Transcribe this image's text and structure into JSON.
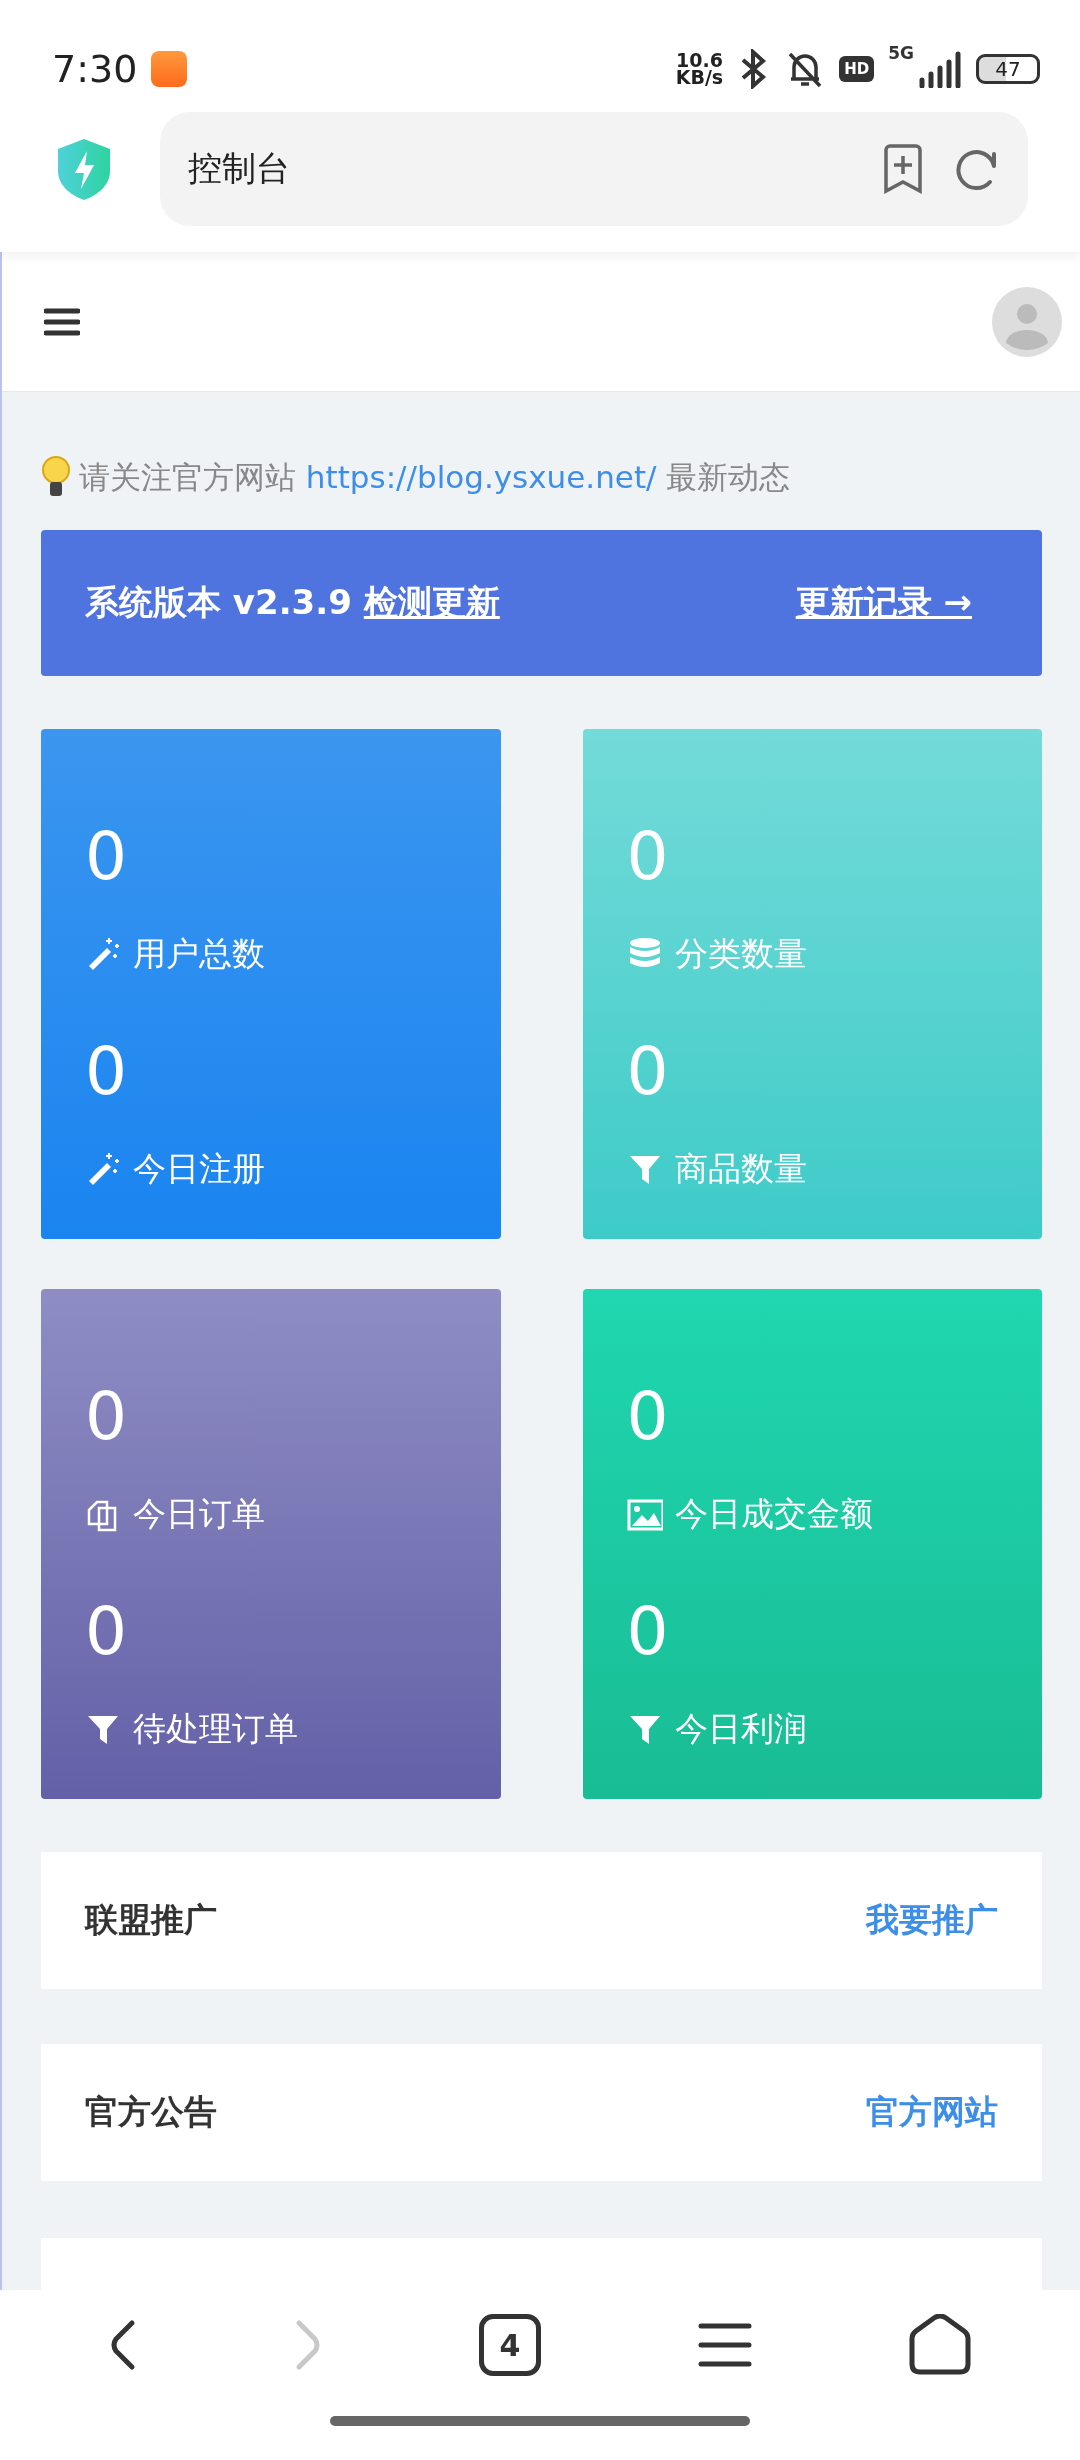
{
  "status_bar": {
    "time": "7:30",
    "speed_value": "10.6",
    "speed_unit": "KB/s",
    "hd": "HD",
    "network": "5G",
    "battery": "47"
  },
  "browser": {
    "address": "控制台",
    "tab_count": "4"
  },
  "notice": {
    "before": "请关注官方网站",
    "link": "https://blog.ysxue.net/",
    "after": "最新动态"
  },
  "version_banner": {
    "label": "系统版本 v2.3.9",
    "check_link": "检测更新",
    "changelog_link": "更新记录 →"
  },
  "cards": [
    {
      "kind": "blue",
      "stats": [
        {
          "value": "0",
          "label": "用户总数",
          "kind": "wand"
        },
        {
          "value": "0",
          "label": "今日注册",
          "kind": "wand"
        }
      ]
    },
    {
      "kind": "cyan",
      "stats": [
        {
          "value": "0",
          "label": "分类数量",
          "kind": "database"
        },
        {
          "value": "0",
          "label": "商品数量",
          "kind": "filter"
        }
      ]
    },
    {
      "kind": "purple",
      "stats": [
        {
          "value": "0",
          "label": "今日订单",
          "kind": "copy"
        },
        {
          "value": "0",
          "label": "待处理订单",
          "kind": "filter"
        }
      ]
    },
    {
      "kind": "green",
      "stats": [
        {
          "value": "0",
          "label": "今日成交金额",
          "kind": "image"
        },
        {
          "value": "0",
          "label": "今日利润",
          "kind": "filter"
        }
      ]
    }
  ],
  "panels": [
    {
      "title": "联盟推广",
      "link": "我要推广"
    },
    {
      "title": "官方公告",
      "link": "官方网站"
    }
  ]
}
